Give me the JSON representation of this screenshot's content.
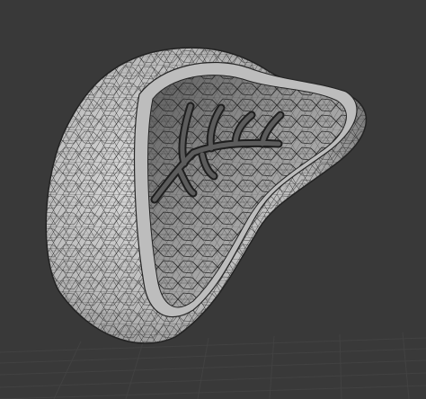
{
  "viewport": {
    "mode": "3d-viewport",
    "shading": "solid",
    "overlay": "wireframe",
    "object": "hollow-organic-shell-with-branching-vessels"
  },
  "colors": {
    "background": "#393939",
    "grid_line": "#434343",
    "mesh_surface_light": "#d9d9d9",
    "mesh_surface_dark": "#7a7a7a",
    "wire": "#2a2a2a",
    "vessel": "#4a4a4a"
  }
}
